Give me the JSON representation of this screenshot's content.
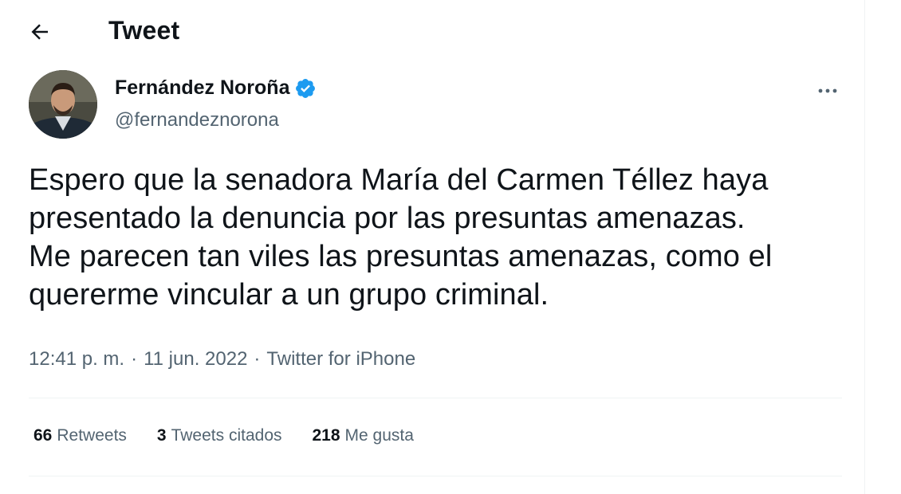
{
  "header": {
    "title": "Tweet",
    "back_icon": "arrow-left-icon"
  },
  "author": {
    "display_name": "Fernández Noroña",
    "handle": "@fernandeznorona",
    "verified": true,
    "verified_color": "#1d9bf0",
    "more_icon": "more-horizontal-icon"
  },
  "tweet": {
    "text": "Espero que la senadora María del Carmen Téllez haya\npresentado la denuncia por las presuntas amenazas.\nMe parecen tan viles las presuntas amenazas, como el\nquererme vincular a un grupo criminal.",
    "time": "12:41 p. m.",
    "separator": "·",
    "date": "11 jun. 2022",
    "source": "Twitter for iPhone"
  },
  "stats": {
    "retweets_count": "66",
    "retweets_label": "Retweets",
    "quotes_count": "3",
    "quotes_label": "Tweets citados",
    "likes_count": "218",
    "likes_label": "Me gusta"
  }
}
